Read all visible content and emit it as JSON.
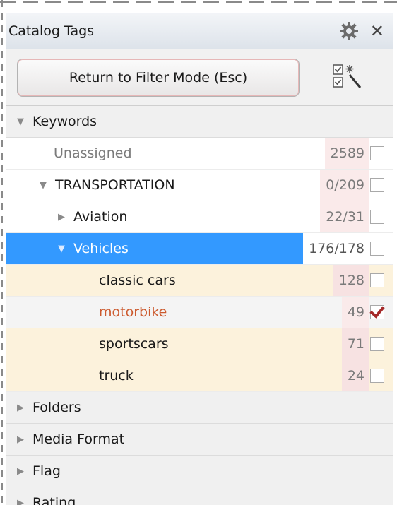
{
  "panel": {
    "title": "Catalog Tags",
    "close_glyph": "✕",
    "icons": {
      "settings": "gear-icon",
      "close": "close-icon",
      "select": "checklist-wand-icon"
    }
  },
  "toolbar": {
    "return_label": "Return to Filter Mode (Esc)"
  },
  "tree": {
    "keywords_label": "Keywords",
    "unassigned": {
      "label": "Unassigned",
      "count": "2589"
    },
    "transportation": {
      "label": "TRANSPORTATION",
      "count": "0/209"
    },
    "aviation": {
      "label": "Aviation",
      "count": "22/31"
    },
    "vehicles": {
      "label": "Vehicles",
      "count": "176/178"
    },
    "classic_cars": {
      "label": "classic cars",
      "count": "128"
    },
    "motorbike": {
      "label": "motorbike",
      "count": "49",
      "checked": true
    },
    "sportscars": {
      "label": "sportscars",
      "count": "71"
    },
    "truck": {
      "label": "truck",
      "count": "24"
    }
  },
  "sections": {
    "folders": "Folders",
    "media_format": "Media Format",
    "flag": "Flag",
    "rating": "Rating"
  },
  "glyphs": {
    "expanded": "▼",
    "collapsed": "▶"
  },
  "colors": {
    "selection": "#3399ff",
    "checkmark": "#a52a2a",
    "highlight_text": "#cc5a2e",
    "row_highlight": "#fcf2dc"
  }
}
